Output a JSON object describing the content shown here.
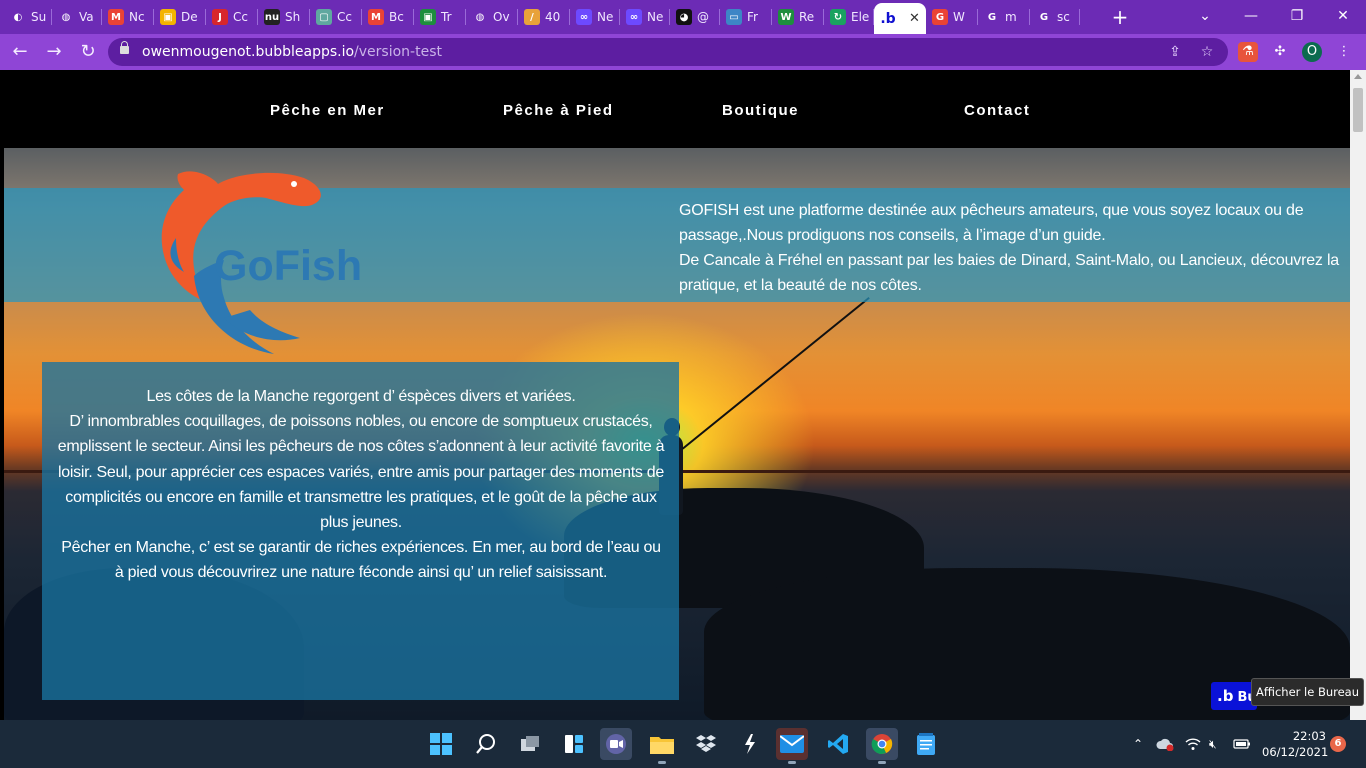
{
  "browser": {
    "tabs": [
      {
        "label": "Su",
        "icon": "google-drive-icon",
        "color": "#e8e8e8",
        "glyph": "◐"
      },
      {
        "label": "Va",
        "icon": "globe-icon",
        "color": "#ffffff",
        "glyph": "◍"
      },
      {
        "label": "Nc",
        "icon": "gmail-icon",
        "color": "#ea4335",
        "glyph": "M"
      },
      {
        "label": "De",
        "icon": "classroom-icon",
        "color": "#f4b400",
        "glyph": "▣"
      },
      {
        "label": "Cc",
        "icon": "j-icon",
        "color": "#d7262c",
        "glyph": "J"
      },
      {
        "label": "Sh",
        "icon": "nu-icon",
        "color": "#222222",
        "glyph": "nu"
      },
      {
        "label": "Cc",
        "icon": "classroom-icon",
        "color": "#5fa8a0",
        "glyph": "▢"
      },
      {
        "label": "Bc",
        "icon": "gmail-icon",
        "color": "#ea4335",
        "glyph": "M"
      },
      {
        "label": "Tr",
        "icon": "classroom-icon",
        "color": "#1e8e3e",
        "glyph": "▣"
      },
      {
        "label": "Ov",
        "icon": "globe-icon",
        "color": "#ffffff",
        "glyph": "◍"
      },
      {
        "label": "40",
        "icon": "pencil-icon",
        "color": "#e8a23a",
        "glyph": "/"
      },
      {
        "label": "Ne",
        "icon": "make-icon",
        "color": "#6d4aff",
        "glyph": "∞"
      },
      {
        "label": "Ne",
        "icon": "make-icon",
        "color": "#6d4aff",
        "glyph": "∞"
      },
      {
        "label": "@",
        "icon": "github-icon",
        "color": "#111111",
        "glyph": "◕"
      },
      {
        "label": "Fr",
        "icon": "laptop-icon",
        "color": "#3d86c6",
        "glyph": "▭"
      },
      {
        "label": "Re",
        "icon": "w-icon",
        "color": "#1e8e3e",
        "glyph": "W"
      },
      {
        "label": "Ele",
        "icon": "refresh-icon",
        "color": "#1aa260",
        "glyph": "↻"
      },
      {
        "label": "",
        "icon": "bubble-icon",
        "color": "#6c2bb5",
        "glyph": ".b",
        "active": true
      },
      {
        "label": "W",
        "icon": "google-icon",
        "color": "#ea4335",
        "glyph": "G"
      },
      {
        "label": "m",
        "icon": "google-icon",
        "color": "#ffffff",
        "glyph": "G"
      },
      {
        "label": "sc",
        "icon": "google-icon",
        "color": "#ffffff",
        "glyph": "G"
      }
    ],
    "url": {
      "host": "owenmougenot.bubbleapps.io",
      "path": "/version-test"
    },
    "profile_initial": "O"
  },
  "site": {
    "nav": [
      "Pêche en Mer",
      "Pêche à Pied",
      "Boutique",
      "Contact"
    ],
    "logo_text": "GoFish",
    "intro": [
      "GOFISH est une platforme destinée aux pêcheurs amateurs, que vous soyez locaux ou de passage,.Nous prodiguons nos conseils, à l’image d’un guide.",
      "De Cancale à Fréhel en passant par les baies de Dinard, Saint-Malo, ou Lancieux, découvrez la pratique, et la beauté de nos côtes."
    ],
    "panel": [
      "Les côtes de la Manche regorgent d’ éspèces divers et variées.",
      "D’ innombrables coquillages,  de poissons nobles, ou encore de somptueux crustacés, emplissent le secteur. Ainsi les pêcheurs de nos côtes s’adonnent à leur activité favorite à loisir. Seul, pour apprécier ces espaces variés, entre amis pour partager des moments de complicités ou encore en famille et transmettre les pratiques, et le goût de la pêche aux plus jeunes.",
      "Pêcher en Manche, c’ est se garantir de riches expériences. En mer, au bord de l’eau ou à pied vous découvrirez une nature féconde ainsi qu’ un relief saisissant."
    ],
    "badge": "Bu",
    "tooltip": "Afficher le Bureau"
  },
  "taskbar": {
    "time": "22:03",
    "date": "06/12/2021",
    "notifications": "6"
  },
  "colors": {
    "tab_bar": "#6c2bb5",
    "toolbar": "#8f45d6",
    "logo_orange": "#ef5a2b",
    "logo_blue": "#2d79b3",
    "band": "#2896be",
    "taskbar": "#1b2a3a"
  }
}
